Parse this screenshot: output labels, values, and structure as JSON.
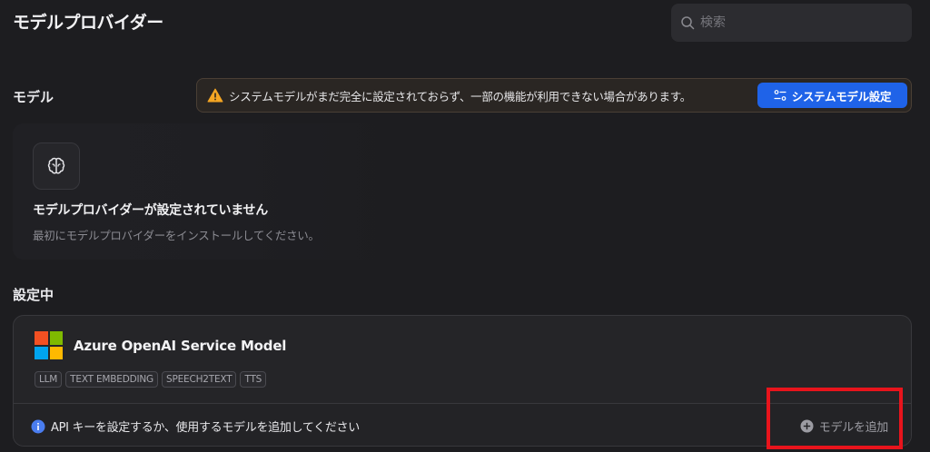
{
  "header": {
    "title": "モデルプロバイダー",
    "search_placeholder": "検索"
  },
  "model_section": {
    "label": "モデル",
    "warning_text": "システムモデルがまだ完全に設定されておらず、一部の機能が利用できない場合があります。",
    "system_settings_button": "システムモデル設定"
  },
  "empty_state": {
    "icon": "brain-icon",
    "title": "モデルプロバイダーが設定されていません",
    "description": "最初にモデルプロバイダーをインストールしてください。"
  },
  "configured_section": {
    "label": "設定中",
    "provider": {
      "logo": "microsoft-logo",
      "name": "Azure OpenAI Service Model",
      "tags": [
        "LLM",
        "TEXT EMBEDDING",
        "SPEECH2TEXT",
        "TTS"
      ],
      "info_text": "API キーを設定するか、使用するモデルを追加してください",
      "add_model_button": "モデルを追加"
    }
  },
  "colors": {
    "background": "#1d1d20",
    "accent_blue": "#1f63e8",
    "warning_orange": "#f5a623",
    "highlight_red": "#e8141c",
    "ms_red": "#f25022",
    "ms_green": "#7fba00",
    "ms_blue": "#00a4ef",
    "ms_yellow": "#ffb900"
  }
}
